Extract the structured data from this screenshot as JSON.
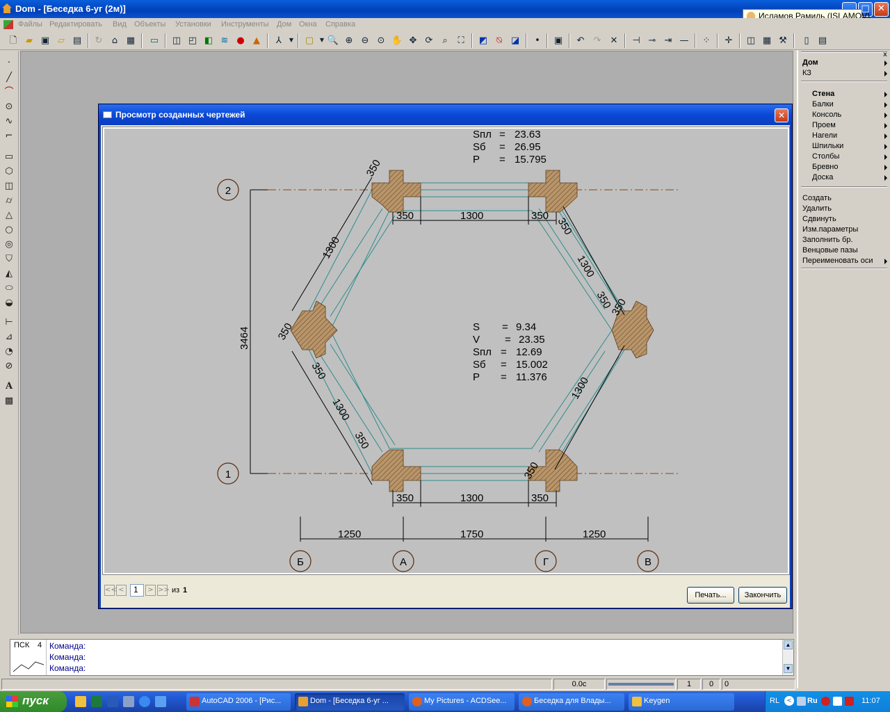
{
  "window": {
    "title": "Dom - [Беседка 6-уг (2м)]",
    "minimize": "_",
    "maximize": "□",
    "close": "✕"
  },
  "user_badge": "Исламов Рамиль (ISLAMOV)",
  "menu": [
    "Файлы",
    "Редактировать",
    "Вид",
    "Объекты",
    "Установки",
    "Инструменты",
    "Дом",
    "Окна",
    "Справка"
  ],
  "right_panel": {
    "header": "Дом",
    "sub_header": "КЗ",
    "category": "Стена",
    "categories": [
      "Балки",
      "Консоль",
      "Проем",
      "Нагели",
      "Шпильки",
      "Столбы",
      "Бревно",
      "Доска"
    ],
    "actions": [
      "Создать",
      "Удалить",
      "Сдвинуть",
      "Изм.параметры",
      "Заполнить бр.",
      "Венцовые пазы",
      "Переименовать оси"
    ],
    "close": "x"
  },
  "dialog": {
    "title": "Просмотр созданных чертежей",
    "close": "✕",
    "pager": {
      "first": "<<",
      "prev": "<",
      "page": "1",
      "next": ">",
      "last": ">>",
      "of_label": "из",
      "total": "1"
    },
    "print_button": "Печать...",
    "finish_button": "Закончить"
  },
  "drawing": {
    "top_stats": [
      {
        "k": "Sпл",
        "v": "23.63"
      },
      {
        "k": "Sб",
        "v": "26.95"
      },
      {
        "k": "P",
        "v": "15.795"
      }
    ],
    "center_stats": [
      {
        "k": "S",
        "v": "9.34"
      },
      {
        "k": "V",
        "v": "23.35"
      },
      {
        "k": "Sпл",
        "v": "12.69"
      },
      {
        "k": "Sб",
        "v": "15.002"
      },
      {
        "k": "P",
        "v": "11.376"
      }
    ],
    "axis_labels": {
      "row2": "2",
      "row1": "1",
      "colB": "Б",
      "colA": "А",
      "colG": "Г",
      "colV": "В"
    },
    "dims": {
      "d350": "350",
      "d1300": "1300",
      "d3464": "3464",
      "d1250": "1250",
      "d1750": "1750"
    }
  },
  "command": {
    "ucs_label": "ПСК",
    "ucs_num": "4",
    "lines": [
      "Команда:",
      "Команда:",
      "Команда:"
    ]
  },
  "statusbar": {
    "coord": "0.0с",
    "v1": "1",
    "v2": "0",
    "v3": "0"
  },
  "taskbar": {
    "start": "пуск",
    "tasks": [
      "AutoCAD 2006 - [Рис...",
      "Dom - [Беседка 6-уг ...",
      "My Pictures - ACDSee...",
      "Беседка для Влады...",
      "Keygen"
    ],
    "lang": "RL",
    "lang2": "Ru",
    "clock": "11:07"
  },
  "colors": {
    "xp_blue": "#0a3fc0",
    "drawing_bg": "#c0c0c0",
    "timber_hatch": "#b8956a",
    "axis_line": "#8b4513",
    "wall_line": "#2e8b8b"
  }
}
